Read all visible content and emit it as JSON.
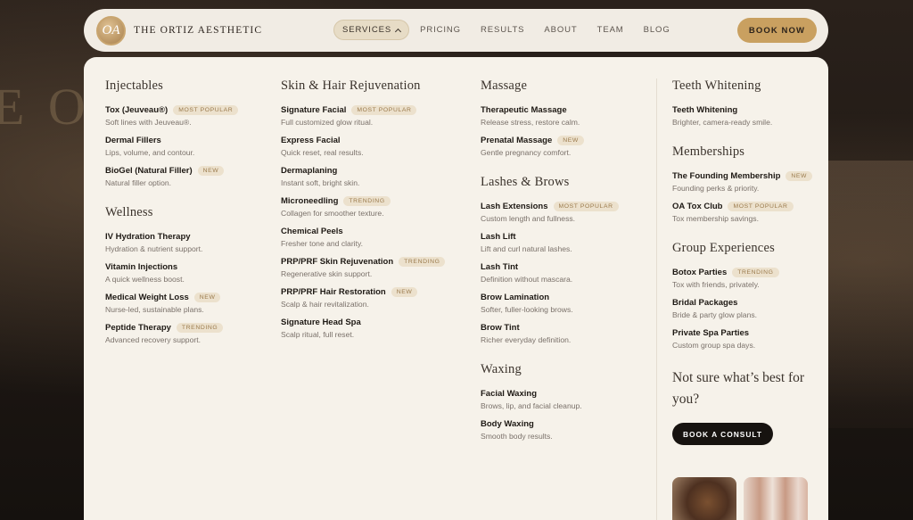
{
  "brand": {
    "name": "THE ORTIZ AESTHETIC",
    "monogram": "OA"
  },
  "nav": {
    "items": [
      "SERVICES",
      "PRICING",
      "RESULTS",
      "ABOUT",
      "TEAM",
      "BLOG"
    ],
    "book_label": "BOOK NOW"
  },
  "colors": {
    "accent": "#c9a060",
    "panel": "#f6f2ea",
    "badge_text": "#9b7b4d"
  },
  "menu": {
    "col1": [
      {
        "title": "Injectables",
        "items": [
          {
            "name": "Tox (Jeuveau®)",
            "badge": "MOST POPULAR",
            "desc": "Soft lines with Jeuveau®."
          },
          {
            "name": "Dermal Fillers",
            "badge": "",
            "desc": "Lips, volume, and contour."
          },
          {
            "name": "BioGel (Natural Filler)",
            "badge": "NEW",
            "desc": "Natural filler option."
          }
        ]
      },
      {
        "title": "Wellness",
        "items": [
          {
            "name": "IV Hydration Therapy",
            "badge": "",
            "desc": "Hydration & nutrient support."
          },
          {
            "name": "Vitamin Injections",
            "badge": "",
            "desc": "A quick wellness boost."
          },
          {
            "name": "Medical Weight Loss",
            "badge": "NEW",
            "desc": "Nurse-led, sustainable plans."
          },
          {
            "name": "Peptide Therapy",
            "badge": "TRENDING",
            "desc": "Advanced recovery support."
          }
        ]
      }
    ],
    "col2": [
      {
        "title": "Skin & Hair Rejuvenation",
        "items": [
          {
            "name": "Signature Facial",
            "badge": "MOST POPULAR",
            "desc": "Full customized glow ritual."
          },
          {
            "name": "Express Facial",
            "badge": "",
            "desc": "Quick reset, real results."
          },
          {
            "name": "Dermaplaning",
            "badge": "",
            "desc": "Instant soft, bright skin."
          },
          {
            "name": "Microneedling",
            "badge": "TRENDING",
            "desc": "Collagen for smoother texture."
          },
          {
            "name": "Chemical Peels",
            "badge": "",
            "desc": "Fresher tone and clarity."
          },
          {
            "name": "PRP/PRF Skin Rejuvenation",
            "badge": "TRENDING",
            "desc": "Regenerative skin support."
          },
          {
            "name": "PRP/PRF Hair Restoration",
            "badge": "NEW",
            "desc": "Scalp & hair revitalization."
          },
          {
            "name": "Signature Head Spa",
            "badge": "",
            "desc": "Scalp ritual, full reset."
          }
        ]
      }
    ],
    "col3": [
      {
        "title": "Massage",
        "items": [
          {
            "name": "Therapeutic Massage",
            "badge": "",
            "desc": "Release stress, restore calm."
          },
          {
            "name": "Prenatal Massage",
            "badge": "NEW",
            "desc": "Gentle pregnancy comfort."
          }
        ]
      },
      {
        "title": "Lashes & Brows",
        "items": [
          {
            "name": "Lash Extensions",
            "badge": "MOST POPULAR",
            "desc": "Custom length and fullness."
          },
          {
            "name": "Lash Lift",
            "badge": "",
            "desc": "Lift and curl natural lashes."
          },
          {
            "name": "Lash Tint",
            "badge": "",
            "desc": "Definition without mascara."
          },
          {
            "name": "Brow Lamination",
            "badge": "",
            "desc": "Softer, fuller-looking brows."
          },
          {
            "name": "Brow Tint",
            "badge": "",
            "desc": "Richer everyday definition."
          }
        ]
      },
      {
        "title": "Waxing",
        "items": [
          {
            "name": "Facial Waxing",
            "badge": "",
            "desc": "Brows, lip, and facial cleanup."
          },
          {
            "name": "Body Waxing",
            "badge": "",
            "desc": "Smooth body results."
          }
        ]
      }
    ],
    "col4": [
      {
        "title": "Teeth Whitening",
        "items": [
          {
            "name": "Teeth Whitening",
            "badge": "",
            "desc": "Brighter, camera-ready smile."
          }
        ]
      },
      {
        "title": "Memberships",
        "items": [
          {
            "name": "The Founding Membership",
            "badge": "NEW",
            "desc": "Founding perks & priority."
          },
          {
            "name": "OA Tox Club",
            "badge": "MOST POPULAR",
            "desc": "Tox membership savings."
          }
        ]
      },
      {
        "title": "Group Experiences",
        "items": [
          {
            "name": "Botox Parties",
            "badge": "TRENDING",
            "desc": "Tox with friends, privately."
          },
          {
            "name": "Bridal Packages",
            "badge": "",
            "desc": "Bride & party glow plans."
          },
          {
            "name": "Private Spa Parties",
            "badge": "",
            "desc": "Custom group spa days."
          }
        ]
      }
    ]
  },
  "consult": {
    "title": "Not sure what’s best for you?",
    "button": "BOOK A CONSULT"
  },
  "background_text": "E O"
}
